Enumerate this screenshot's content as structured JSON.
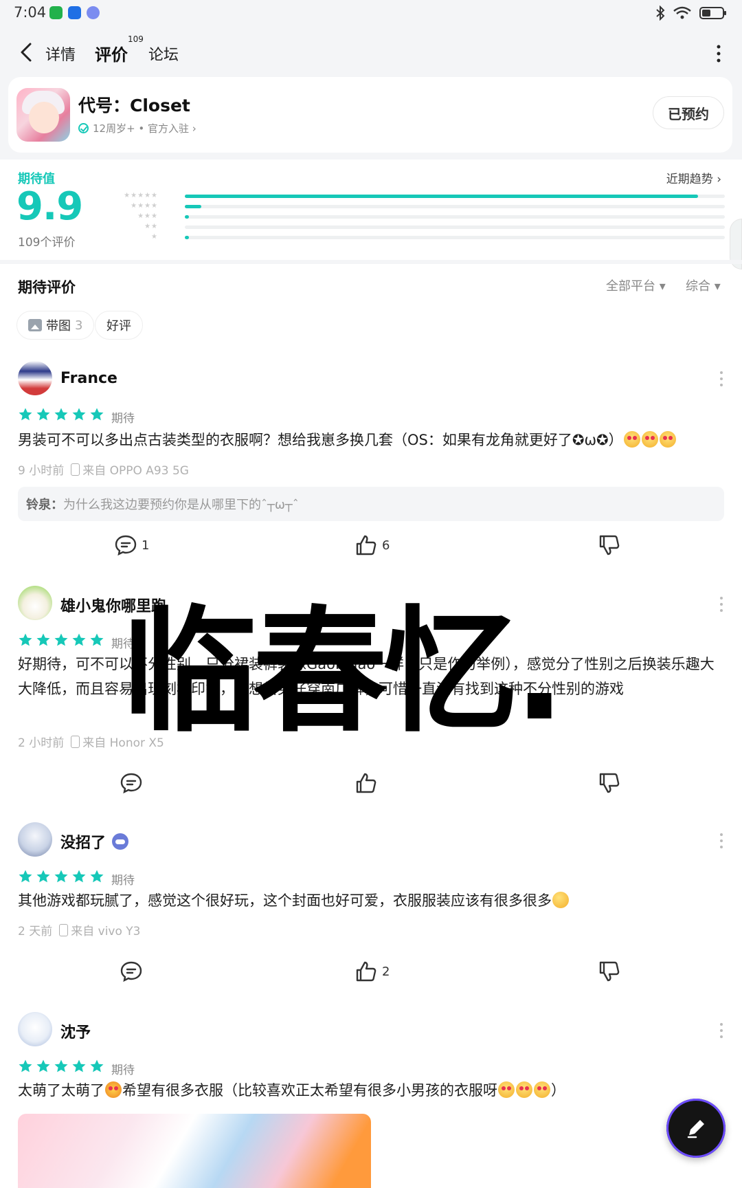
{
  "status_bar": {
    "time": "7:04"
  },
  "nav": {
    "tab_detail": "详情",
    "tab_review": "评价",
    "review_count": "109",
    "tab_forum": "论坛"
  },
  "app": {
    "title": "代号：Closet",
    "meta": "12周岁+ • 官方入驻 ›",
    "reserve_label": "已预约"
  },
  "rating": {
    "label": "期待值",
    "score": "9.9",
    "count": "109个评价",
    "trend_link": "近期趋势 ›",
    "distribution": [
      {
        "stars": 5,
        "fraction": 0.95
      },
      {
        "stars": 4,
        "fraction": 0.03
      },
      {
        "stars": 3,
        "fraction": 0.005
      },
      {
        "stars": 2,
        "fraction": 0.0
      },
      {
        "stars": 1,
        "fraction": 0.005
      }
    ],
    "accent_color": "#16c8b8"
  },
  "list": {
    "title": "期待评价",
    "filter_platform": "全部平台 ▾",
    "filter_sort": "综合 ▾",
    "chips": [
      {
        "label": "带图",
        "count": "3"
      },
      {
        "label": "好评"
      }
    ]
  },
  "reviews": [
    {
      "user": "France",
      "stars_label": "期待",
      "text": "男装可不可以多出点古装类型的衣服啊？想给我崽多换几套（OS：如果有龙角就更好了✪ω✪）",
      "time": "9 小时前",
      "device": "来自 OPPO A93 5G",
      "reply_name": "铃泉：",
      "reply_text": "为什么我这边要预约你是从哪里下的ˆ┬ω┬ˆ",
      "comments": "1",
      "likes": "6"
    },
    {
      "user": "雄小鬼你哪里跑",
      "stars_label": "期待",
      "text": "好期待，可不可以不分性别，只分裙装裤装像Gaobidao一样（只是作为举例），感觉分了性别之后换装乐趣大大降低，而且容易出现刻板印象，真想给男仔穿南广裤，可惜一直没有找到这种不分性别的游戏",
      "time": "2 小时前",
      "device": "来自 Honor X5",
      "comments": "",
      "likes": ""
    },
    {
      "user": "没招了",
      "stars_label": "期待",
      "text": "其他游戏都玩腻了，感觉这个很好玩，这个封面也好可爱，衣服服装应该有很多很多",
      "time": "2 天前",
      "device": "来自 vivo Y3",
      "comments": "",
      "likes": "2"
    },
    {
      "user": "沈予",
      "stars_label": "期待",
      "text_a": "太萌了太萌了",
      "text_b": "希望有很多衣服（比较喜欢正太希望有很多小男孩的衣服呀",
      "text_c": "）"
    }
  ],
  "watermark": "临春忆."
}
